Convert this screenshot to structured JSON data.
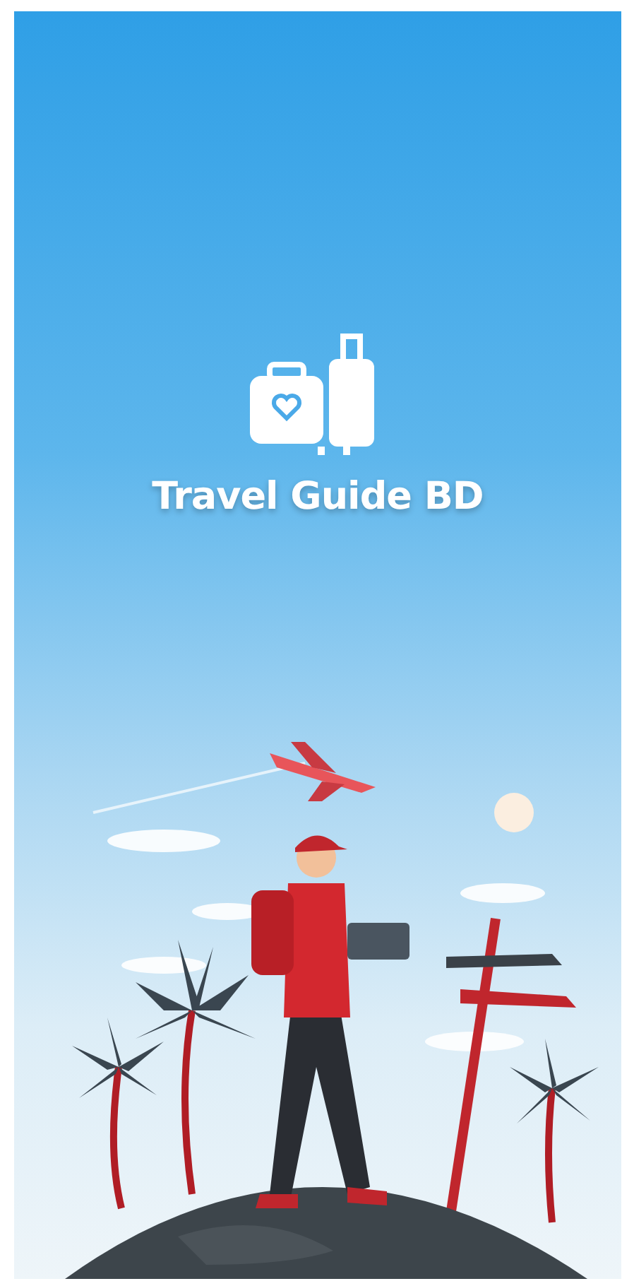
{
  "app": {
    "title": "Travel Guide BD"
  }
}
